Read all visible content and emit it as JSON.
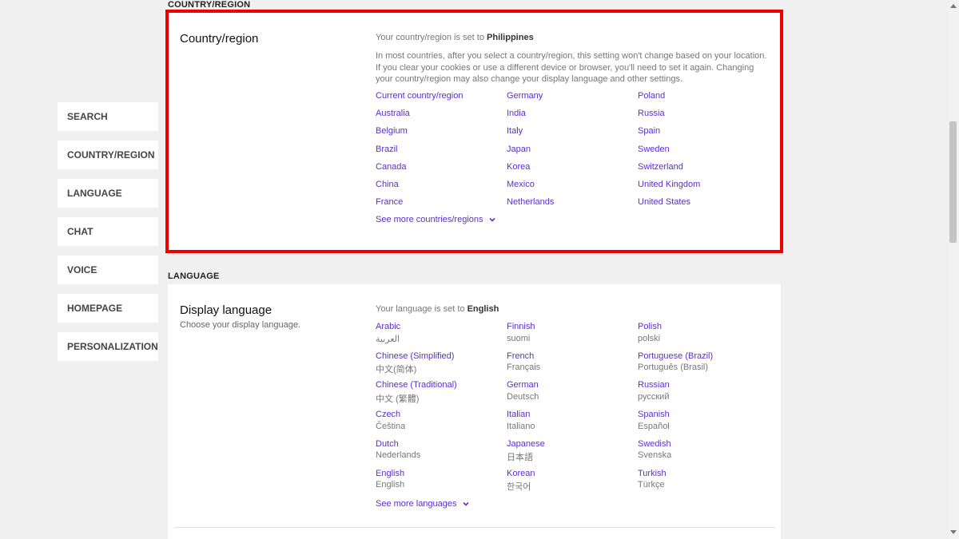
{
  "nav": {
    "items": [
      {
        "label": "SEARCH"
      },
      {
        "label": "COUNTRY/REGION"
      },
      {
        "label": "LANGUAGE"
      },
      {
        "label": "CHAT"
      },
      {
        "label": "VOICE"
      },
      {
        "label": "HOMEPAGE"
      },
      {
        "label": "PERSONALIZATION"
      }
    ]
  },
  "country_section": {
    "heading": "COUNTRY/REGION",
    "title": "Country/region",
    "status_prefix": "Your country/region is set to ",
    "status_value": "Philippines",
    "description": "In most countries, after you select a country/region, this setting won't change based on your location. If you clear your cookies or use a different device or browser, you'll need to set it again. Changing your country/region may also change your display language and other settings.",
    "columns": [
      [
        "Current country/region",
        "Australia",
        "Belgium",
        "Brazil",
        "Canada",
        "China",
        "France"
      ],
      [
        "Germany",
        "India",
        "Italy",
        "Japan",
        "Korea",
        "Mexico",
        "Netherlands"
      ],
      [
        "Poland",
        "Russia",
        "Spain",
        "Sweden",
        "Switzerland",
        "United Kingdom",
        "United States"
      ]
    ],
    "see_more": "See more countries/regions"
  },
  "language_section": {
    "heading": "LANGUAGE",
    "title": "Display language",
    "subtitle": "Choose your display language.",
    "status_prefix": "Your language is set to ",
    "status_value": "English",
    "columns": [
      [
        {
          "name": "Arabic",
          "native": "العربية"
        },
        {
          "name": "Chinese (Simplified)",
          "native": "中文(简体)"
        },
        {
          "name": "Chinese (Traditional)",
          "native": "中文 (繁體)"
        },
        {
          "name": "Czech",
          "native": "Čeština"
        },
        {
          "name": "Dutch",
          "native": "Nederlands"
        },
        {
          "name": "English",
          "native": "English"
        }
      ],
      [
        {
          "name": "Finnish",
          "native": "suomi"
        },
        {
          "name": "French",
          "native": "Français"
        },
        {
          "name": "German",
          "native": "Deutsch"
        },
        {
          "name": "Italian",
          "native": "Italiano"
        },
        {
          "name": "Japanese",
          "native": "日本語"
        },
        {
          "name": "Korean",
          "native": "한국어"
        }
      ],
      [
        {
          "name": "Polish",
          "native": "polski"
        },
        {
          "name": "Portuguese (Brazil)",
          "native": "Português (Brasil)"
        },
        {
          "name": "Russian",
          "native": "русский"
        },
        {
          "name": "Spanish",
          "native": "Español"
        },
        {
          "name": "Swedish",
          "native": "Svenska"
        },
        {
          "name": "Turkish",
          "native": "Türkçe"
        }
      ]
    ],
    "see_more": "See more languages"
  },
  "colors": {
    "link": "#5b2fc9",
    "highlight": "#ee0000",
    "background": "#f0f0f0"
  }
}
